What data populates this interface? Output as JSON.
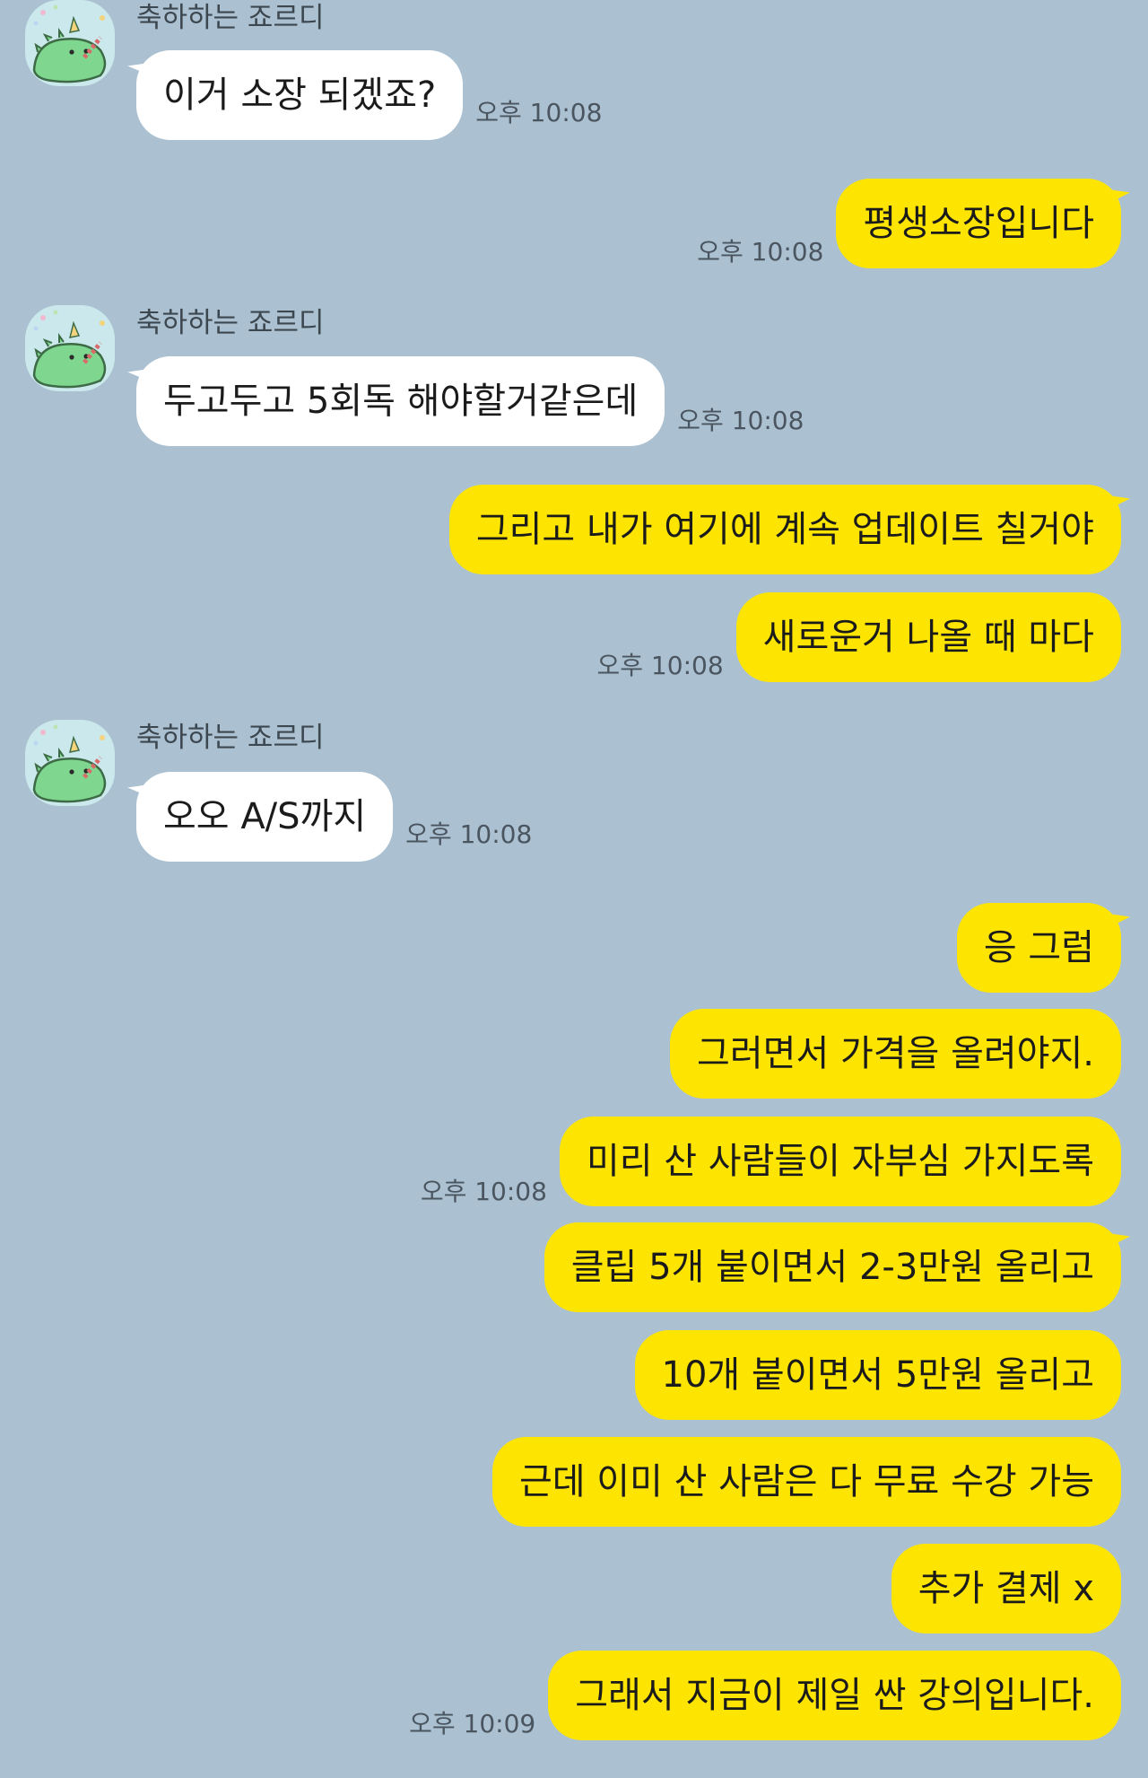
{
  "sender_name": "축하하는 죠르디",
  "messages": [
    {
      "dir": "in",
      "text": "이거 소장 되겠죠?",
      "time": "오후 10:08"
    },
    {
      "dir": "out",
      "text": "평생소장입니다",
      "time": "오후 10:08"
    },
    {
      "dir": "in",
      "text": "두고두고 5회독 해야할거같은데",
      "time": "오후 10:08"
    },
    {
      "dir": "out",
      "text": "그리고 내가 여기에 계속 업데이트 칠거야",
      "time": ""
    },
    {
      "dir": "out",
      "text": "새로운거 나올 때 마다",
      "time": "오후 10:08"
    },
    {
      "dir": "in",
      "text": "오오 A/S까지",
      "time": "오후 10:08"
    },
    {
      "dir": "out",
      "text": "응 그럼",
      "time": ""
    },
    {
      "dir": "out",
      "text": "그러면서 가격을 올려야지.",
      "time": ""
    },
    {
      "dir": "out",
      "text": "미리 산 사람들이 자부심 가지도록",
      "time": "오후 10:08"
    },
    {
      "dir": "out",
      "text": "클립 5개 붙이면서 2-3만원 올리고",
      "time": ""
    },
    {
      "dir": "out",
      "text": "10개 붙이면서 5만원 올리고",
      "time": ""
    },
    {
      "dir": "out",
      "text": "근데 이미 산 사람은 다 무료 수강 가능",
      "time": ""
    },
    {
      "dir": "out",
      "text": "추가 결제 x",
      "time": ""
    },
    {
      "dir": "out",
      "text": "그래서 지금이 제일 싼 강의입니다.",
      "time": "오후 10:09"
    }
  ],
  "avatar_icon": "jordy-dinosaur-icon",
  "colors": {
    "background": "#abc1d1",
    "incoming_bubble": "#ffffff",
    "outgoing_bubble": "#fee501",
    "avatar_bg": "#cbe9ec",
    "jordy_green": "#7fd68f"
  }
}
